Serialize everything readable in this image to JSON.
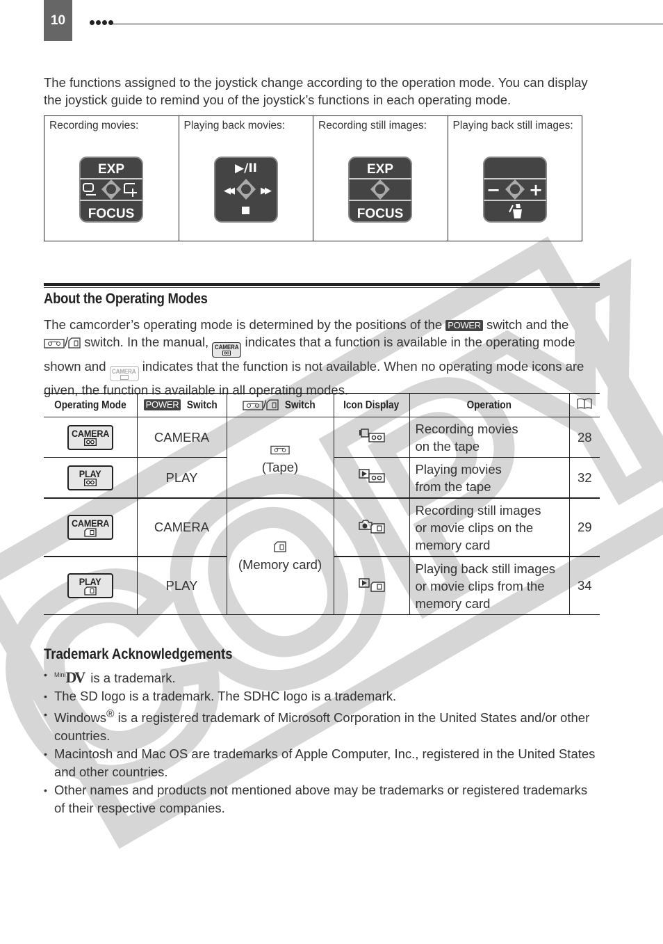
{
  "page": {
    "number": "10",
    "intro": "The functions assigned to the joystick change according to the operation mode. You can display the joystick guide to remind you of the joystick’s functions in each operating mode."
  },
  "joystick_guide": [
    {
      "label": "Recording movies:",
      "top": "EXP",
      "left_icon": "zoom-out-frame-icon",
      "right_icon": "zoom-in-frame-icon",
      "bottom": "FOCUS"
    },
    {
      "label": "Playing back movies:",
      "top": "▶/II",
      "left": "◀◀",
      "right": "▶▶",
      "bottom": "■"
    },
    {
      "label": "Recording still images:",
      "top": "EXP",
      "bottom": "FOCUS"
    },
    {
      "label": "Playing back still images:",
      "top": "",
      "left": "−",
      "right": "+",
      "bottom_icon": "protect-delete-icon"
    }
  ],
  "operating_modes": {
    "title": "About the Operating Modes",
    "para": {
      "p1": "The camcorder’s operating mode is determined by the positions of the",
      "power": "POWER",
      "p2": "switch and the",
      "p3": "switch. In the manual,",
      "p4": "indicates that a function is available in the operating mode shown and",
      "p5": "indicates that the function is not available. When no operating mode icons are given, the function is available in all operating modes.",
      "badge_text": "CAMERA"
    },
    "table": {
      "headers": {
        "mode": "Operating Mode",
        "power_badge": "POWER",
        "power": "Switch",
        "media": "Switch",
        "icon": "Icon Display",
        "operation": "Operation",
        "page": "book-icon"
      },
      "media_groups": [
        {
          "label": "(Tape)"
        },
        {
          "label": "(Memory card)"
        }
      ],
      "rows": [
        {
          "mode_badge": "CAMERA",
          "media": "tape",
          "power": "CAMERA",
          "operation_l1": "Recording movies",
          "operation_l2": "on the tape",
          "operation_l3": "",
          "page": "28"
        },
        {
          "mode_badge": "PLAY",
          "media": "tape",
          "power": "PLAY",
          "operation_l1": "Playing movies",
          "operation_l2": "from the tape",
          "operation_l3": "",
          "page": "32"
        },
        {
          "mode_badge": "CAMERA",
          "media": "card",
          "power": "CAMERA",
          "operation_l1": "Recording still images",
          "operation_l2": "or movie clips on the",
          "operation_l3": "memory card",
          "page": "29"
        },
        {
          "mode_badge": "PLAY",
          "media": "card",
          "power": "PLAY",
          "operation_l1": "Playing back still images",
          "operation_l2": "or movie clips from the",
          "operation_l3": "memory card",
          "page": "34"
        }
      ]
    }
  },
  "trademarks": {
    "title": "Trademark Acknowledgements",
    "mini": "Mini",
    "dv": "DV",
    "items": [
      "is a trademark.",
      "The SD logo is a trademark. The SDHC logo is a trademark.",
      "Windows",
      "Macintosh and Mac OS are trademarks of Apple Computer, Inc., registered in the United States and other countries.",
      "Other names and products not mentioned above may be trademarks or registered trademarks of their respective companies."
    ],
    "windows_reg": "®",
    "windows_rest": "is a registered trademark of Microsoft Corporation in the United States and/or other countries."
  },
  "watermark": "COPY"
}
